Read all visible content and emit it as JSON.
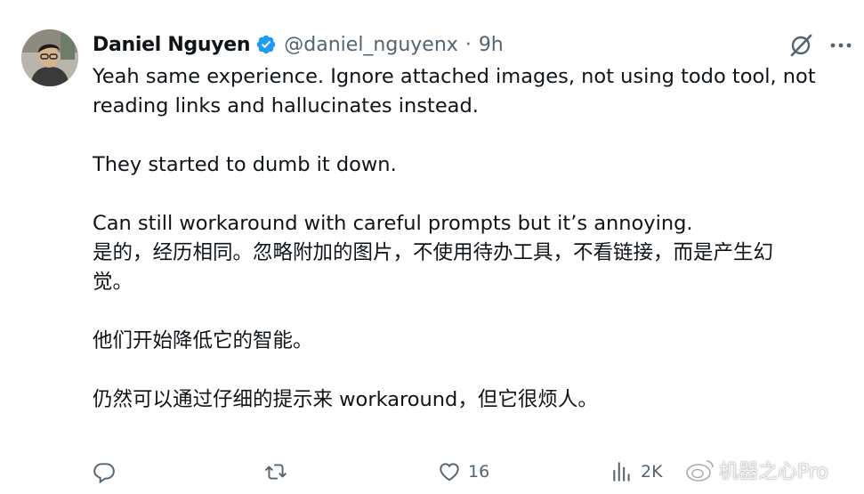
{
  "author": {
    "name": "Daniel Nguyen",
    "handle": "@daniel_nguyenx",
    "separator": "·",
    "time": "9h"
  },
  "tweet": {
    "en_line1": "Yeah same experience. Ignore attached images, not using todo tool, not",
    "en_line2": "reading links and hallucinates instead.",
    "en_line3": "They started to dumb it down.",
    "en_line4": "Can still workaround with careful prompts but it’s annoying.",
    "cn_line1": "是的，经历相同。忽略附加的图片，不使用待办工具，不看链接，而是产生幻",
    "cn_line2": "觉。",
    "cn_line3": "他们开始降低它的智能。",
    "cn_line4": "仍然可以通过仔细的提示来 workaround，但它很烦人。"
  },
  "actions": {
    "reply_count": "",
    "retweet_count": "",
    "like_count": "16",
    "views_count": "2K"
  },
  "watermark": {
    "text": "机器之心Pro"
  },
  "icons": {
    "verified": "verified-badge-icon",
    "grok": "grok-icon",
    "more": "more-icon",
    "reply": "reply-icon",
    "retweet": "retweet-icon",
    "like": "heart-icon",
    "views": "views-icon"
  },
  "colors": {
    "text": "#0f1419",
    "secondary": "#536471",
    "verified": "#1d9bf0"
  }
}
